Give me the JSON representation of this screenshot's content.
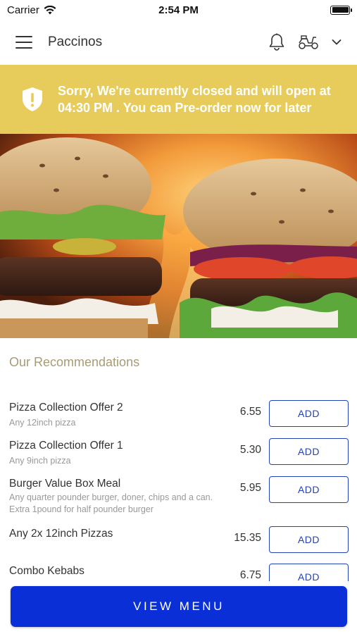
{
  "status_bar": {
    "carrier": "Carrier",
    "time": "2:54 PM"
  },
  "header": {
    "title": "Paccinos",
    "icons": [
      "hamburger-menu-icon",
      "bell-icon",
      "scooter-icon",
      "chevron-down-icon"
    ]
  },
  "banner": {
    "text": "Sorry, We're currently closed and will open at 04:30 PM . You can Pre-order now for later",
    "background": "#e8cc5b",
    "icon": "shield-alert-icon"
  },
  "hero": {
    "image": "burgers-over-flames"
  },
  "recommendations": {
    "title": "Our Recommendations",
    "add_label": "ADD",
    "items": [
      {
        "name": "Pizza Collection Offer 2",
        "description": "Any 12inch pizza",
        "price": "6.55"
      },
      {
        "name": "Pizza Collection Offer 1",
        "description": "Any 9inch pizza",
        "price": "5.30"
      },
      {
        "name": "Burger Value Box Meal",
        "description": "Any quarter pounder burger, doner, chips and a can. Extra 1pound for half pounder burger",
        "price": "5.95"
      },
      {
        "name": "Any 2x 12inch Pizzas",
        "description": "",
        "price": "15.35"
      },
      {
        "name": "Combo Kebabs",
        "description": "",
        "price": "6.75"
      }
    ]
  },
  "view_menu": {
    "label": "VIEW MENU",
    "color": "#0a2fd6"
  },
  "colors": {
    "accent": "#2342b5",
    "section_title": "#a89b76"
  }
}
